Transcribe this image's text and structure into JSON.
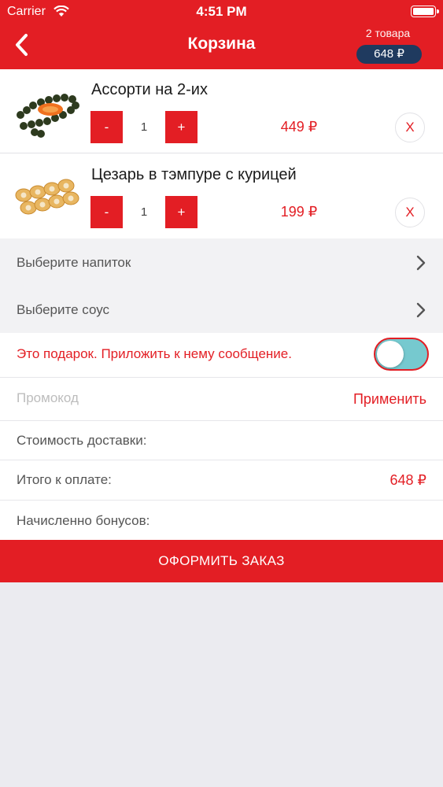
{
  "status_bar": {
    "carrier": "Carrier",
    "time": "4:51 PM"
  },
  "nav": {
    "title": "Корзина",
    "cart_count": "2 товара",
    "cart_total": "648 ₽"
  },
  "items": [
    {
      "name": "Ассорти на 2-их",
      "qty": "1",
      "price": "449 ₽",
      "minus": "-",
      "plus": "+",
      "remove": "X"
    },
    {
      "name": "Цезарь в тэмпуре с курицей",
      "qty": "1",
      "price": "199 ₽",
      "minus": "-",
      "plus": "+",
      "remove": "X"
    }
  ],
  "options": {
    "drink": "Выберите напиток",
    "sauce": "Выберите соус"
  },
  "gift": {
    "label": "Это подарок. Приложить к нему сообщение.",
    "enabled": true
  },
  "promo": {
    "placeholder": "Промокод",
    "value": "",
    "apply_label": "Применить"
  },
  "delivery": {
    "label": "Стоимость доставки:"
  },
  "total": {
    "label": "Итого к оплате:",
    "value": "648 ₽"
  },
  "bonus": {
    "label": "Начисленно бонусов:"
  },
  "checkout": {
    "label": "ОФОРМИТЬ ЗАКАЗ"
  },
  "colors": {
    "accent": "#e31e24",
    "badge": "#1f3a5f",
    "toggle_on": "#76c9cf",
    "background": "#ebebf0"
  }
}
